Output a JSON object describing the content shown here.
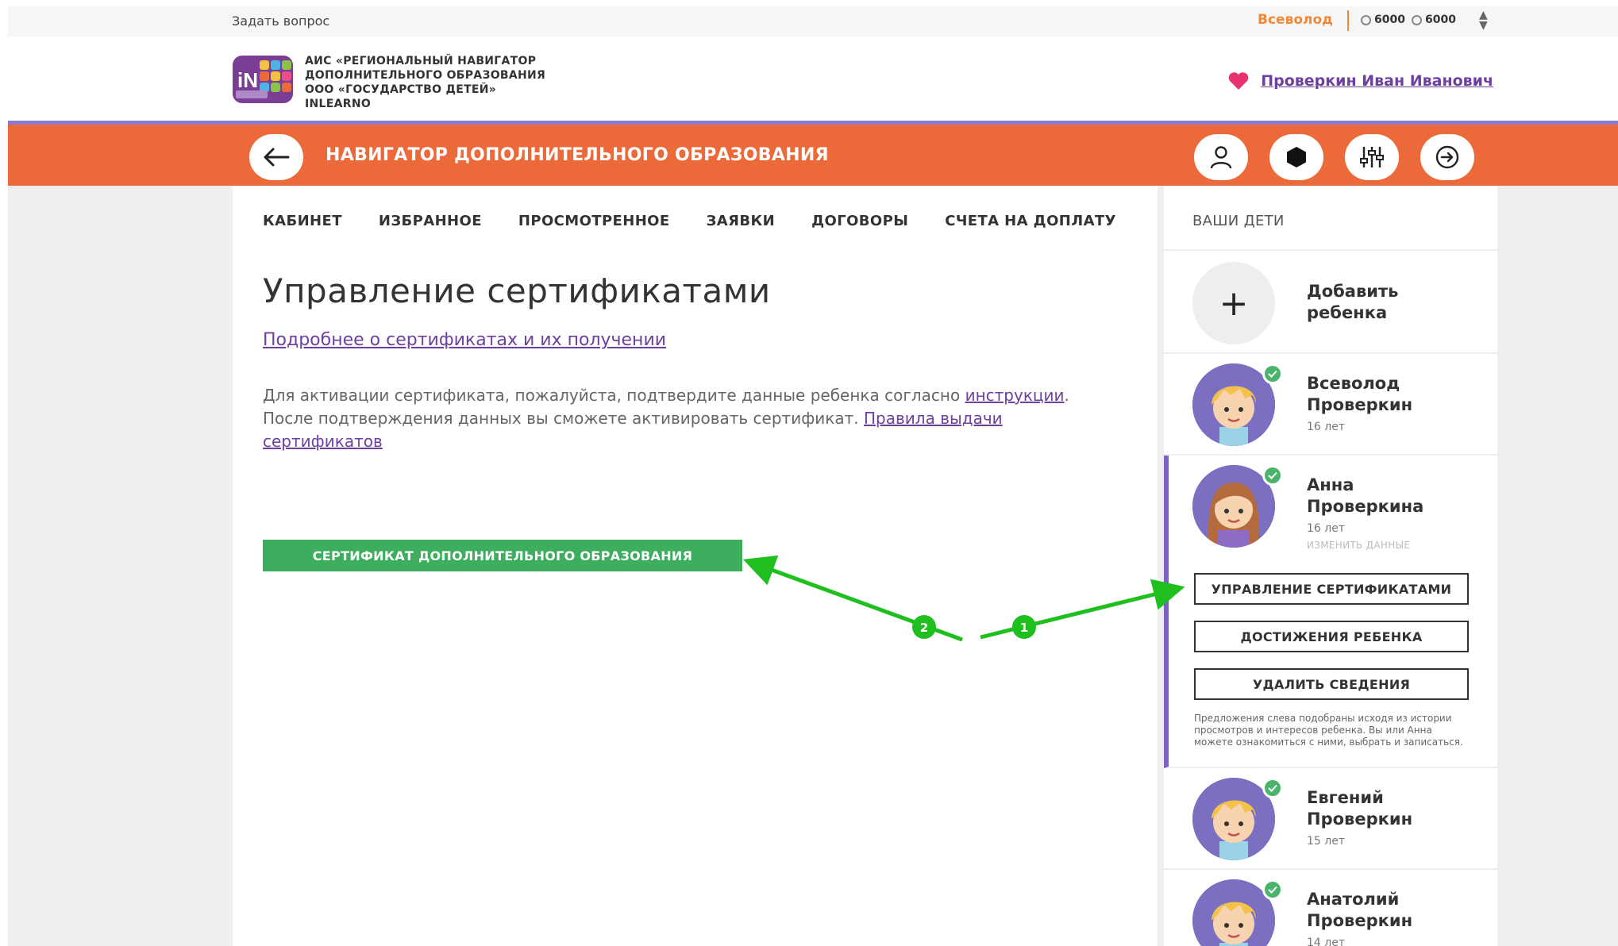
{
  "util": {
    "ask": "Задать вопрос",
    "user_short": "Всеволод",
    "balance1": "6000",
    "balance2": "6000"
  },
  "header": {
    "org_line1": "АИС «РЕГИОНАЛЬНЫЙ НАВИГАТОР",
    "org_line2": "ДОПОЛНИТЕЛЬНОГО ОБРАЗОВАНИЯ",
    "org_line3": "ООО «ГОСУДАРСТВО ДЕТЕЙ»",
    "org_line4": "INLEARNO",
    "profile_name": "Проверкин Иван Иванович"
  },
  "orange": {
    "title": "НАВИГАТОР ДОПОЛНИТЕЛЬНОГО ОБРАЗОВАНИЯ"
  },
  "tabs": [
    "КАБИНЕТ",
    "ИЗБРАННОЕ",
    "ПРОСМОТРЕННОЕ",
    "ЗАЯВКИ",
    "ДОГОВОРЫ",
    "СЧЕТА НА ДОПЛАТУ"
  ],
  "main": {
    "title": "Управление сертификатами",
    "more_link": "Подробнее о сертификатах и их получении",
    "para_text1": "Для активации сертификата, пожалуйста, подтвердите данные ребенка согласно ",
    "para_link1": "инструкции",
    "para_text2": ".",
    "para_text3": "После подтверждения данных вы сможете активировать сертификат. ",
    "para_link2": "Правила выдачи",
    "para_link3": "сертификатов",
    "cert_button": "СЕРТИФИКАТ ДОПОЛНИТЕЛЬНОГО ОБРАЗОВАНИЯ"
  },
  "side": {
    "heading": "ВАШИ ДЕТИ",
    "add_line1": "Добавить",
    "add_line2": "ребенка",
    "children": [
      {
        "first": "Всеволод",
        "last": "Проверкин",
        "age": "16 лет"
      },
      {
        "first": "Анна",
        "last": "Проверкина",
        "age": "16 лет",
        "edit": "ИЗМЕНИТЬ ДАННЫЕ"
      },
      {
        "first": "Евгений",
        "last": "Проверкин",
        "age": "15 лет"
      },
      {
        "first": "Анатолий",
        "last": "Проверкин",
        "age": "14 лет"
      }
    ],
    "btn_manage": "УПРАВЛЕНИЕ СЕРТИФИКАТАМИ",
    "btn_achievements": "ДОСТИЖЕНИЯ РЕБЕНКА",
    "btn_delete": "УДАЛИТЬ СВЕДЕНИЯ",
    "hint": "Предложения слева подобраны исходя из истории просмотров и интересов ребенка. Вы или Анна можете ознакомиться с ними, выбрать и записаться."
  },
  "annotations": {
    "marker1": "1",
    "marker2": "2"
  },
  "colors": {
    "orange": "#ec6a3a",
    "purple": "#6d3fa0",
    "green": "#3dae5e",
    "arrow_green": "#1fbf1f"
  }
}
